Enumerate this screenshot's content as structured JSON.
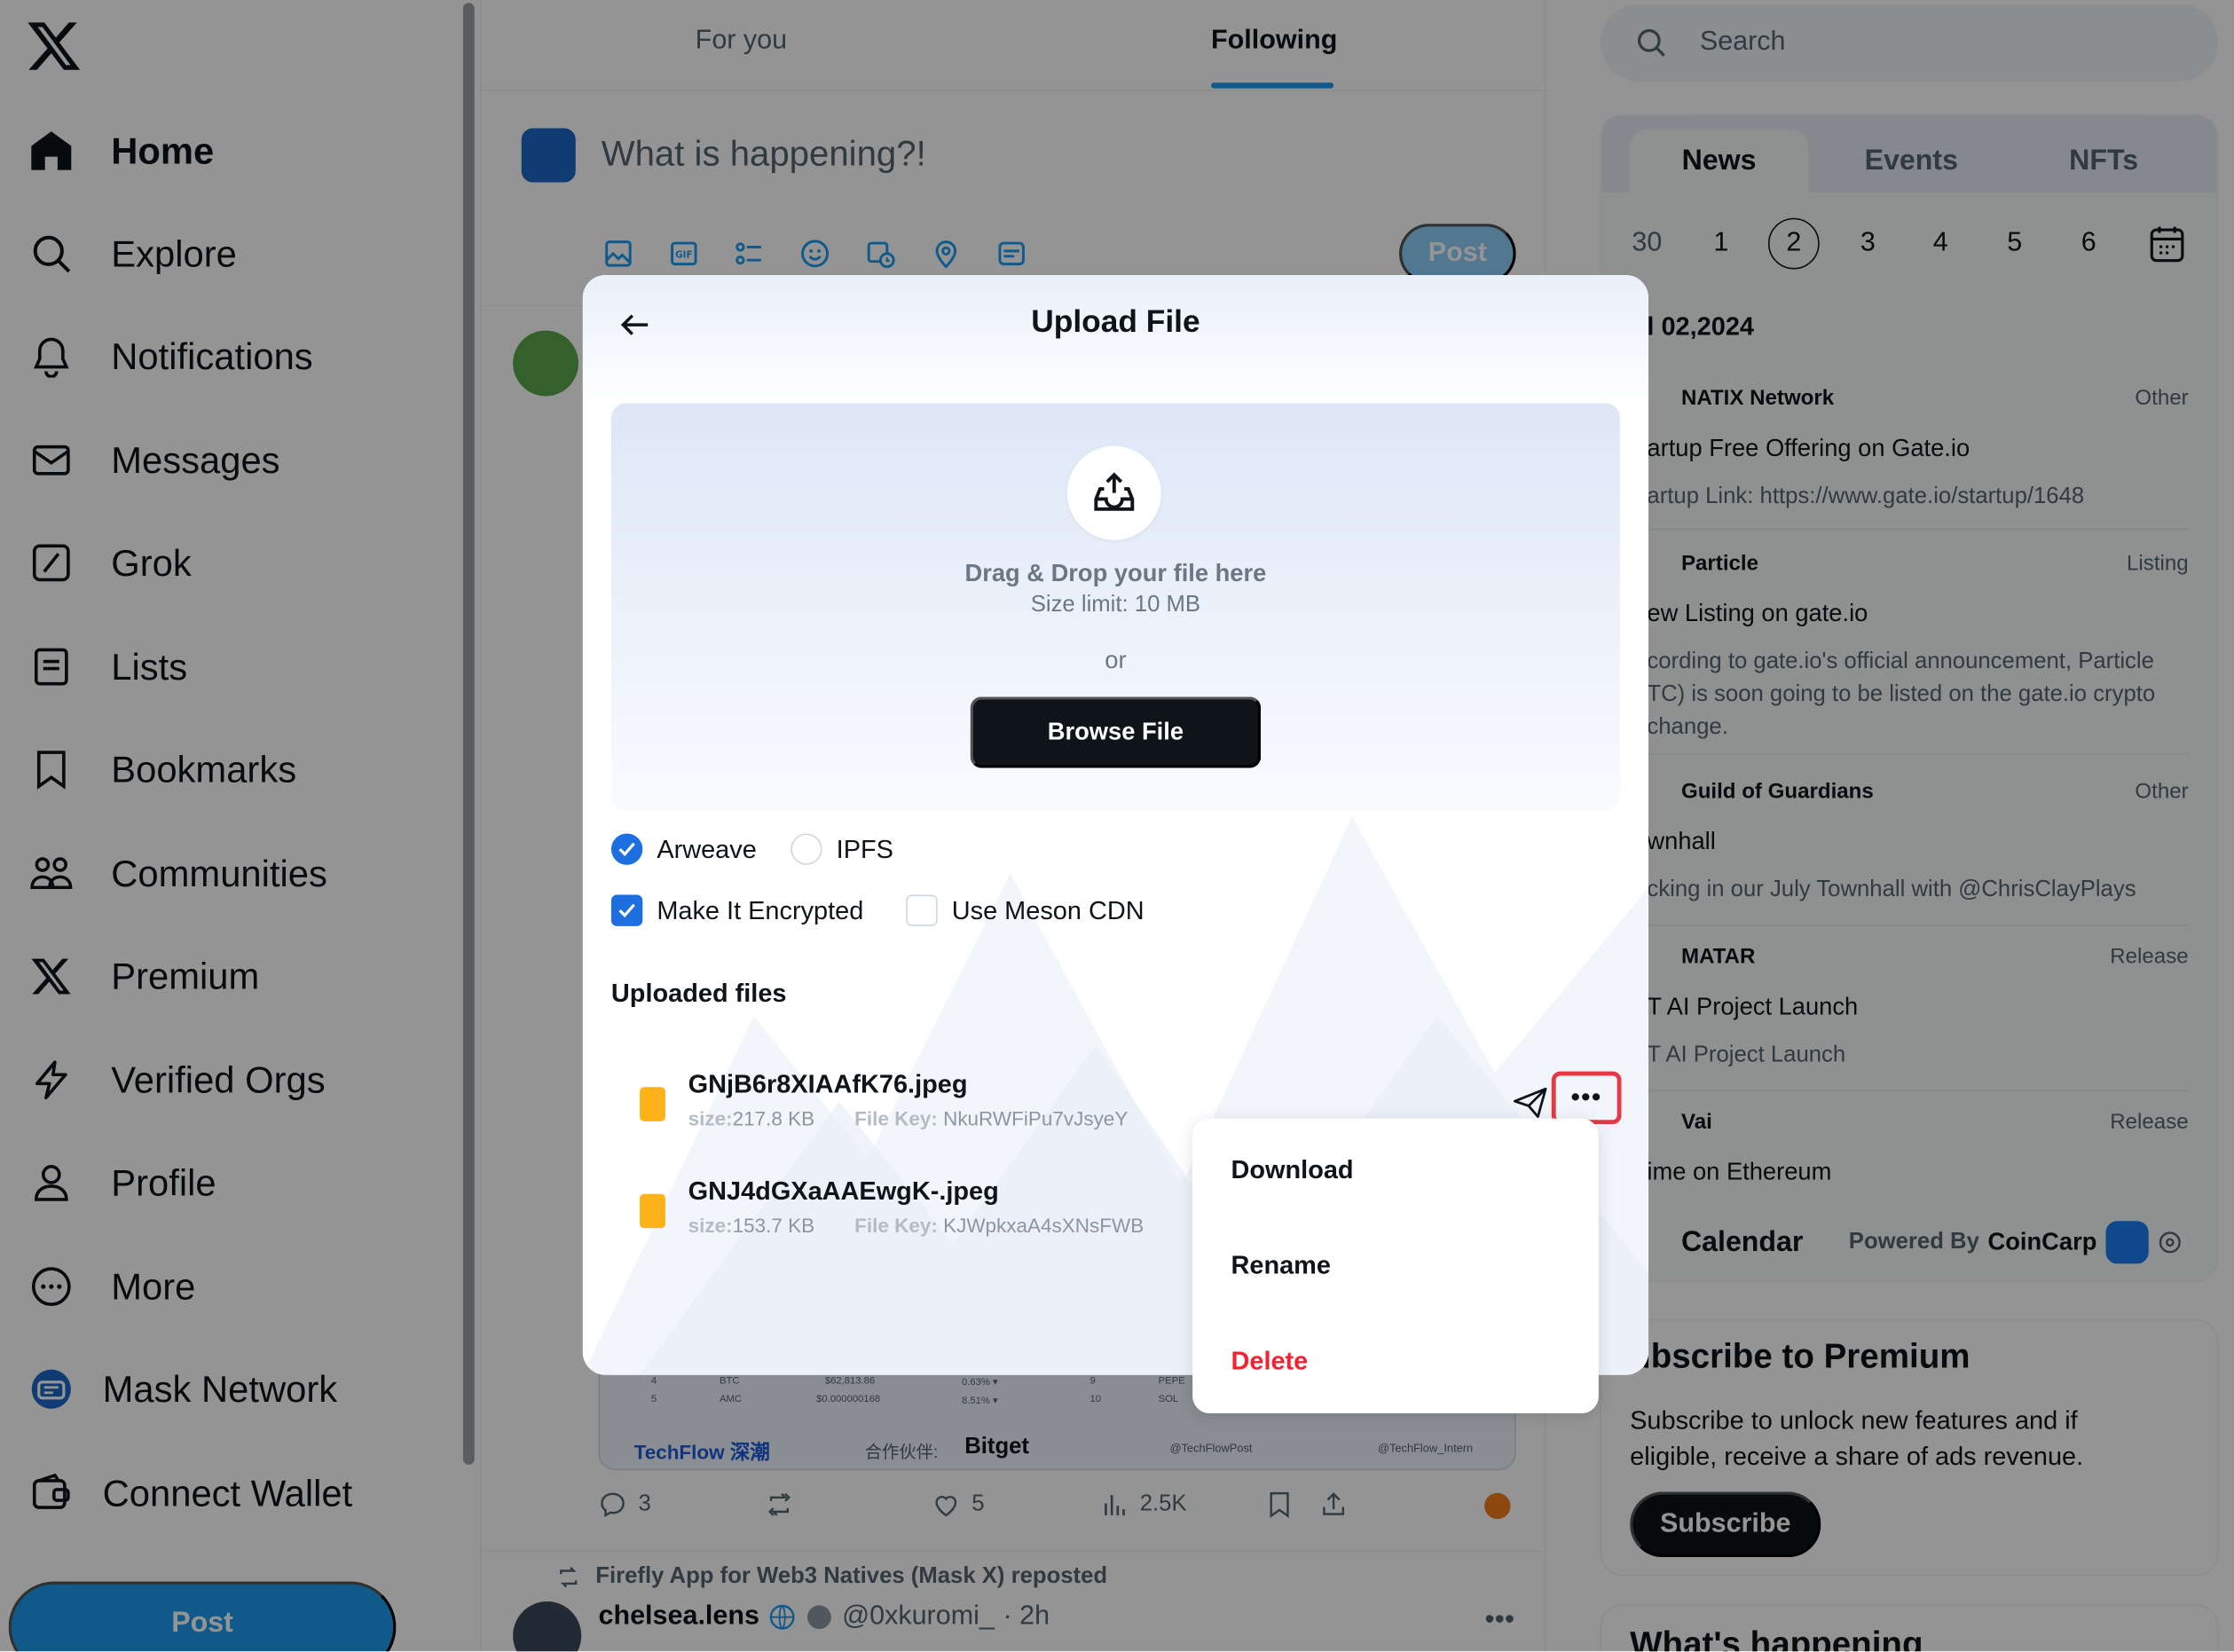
{
  "sidebar": {
    "logo_icon": "x-logo-icon",
    "items": [
      {
        "label": "Home",
        "icon": "home-icon",
        "active": true
      },
      {
        "label": "Explore",
        "icon": "search-icon"
      },
      {
        "label": "Notifications",
        "icon": "bell-icon"
      },
      {
        "label": "Messages",
        "icon": "envelope-icon"
      },
      {
        "label": "Grok",
        "icon": "grok-icon"
      },
      {
        "label": "Lists",
        "icon": "list-icon"
      },
      {
        "label": "Bookmarks",
        "icon": "bookmark-icon"
      },
      {
        "label": "Communities",
        "icon": "people-icon"
      },
      {
        "label": "Premium",
        "icon": "x-premium-icon"
      },
      {
        "label": "Verified Orgs",
        "icon": "lightning-icon"
      },
      {
        "label": "Profile",
        "icon": "person-icon"
      },
      {
        "label": "More",
        "icon": "more-circle-icon"
      },
      {
        "label": "Mask Network",
        "icon": "mask-network-icon"
      },
      {
        "label": "Connect Wallet",
        "icon": "wallet-icon"
      }
    ],
    "post_label": "Post"
  },
  "timeline": {
    "tabs": [
      {
        "label": "For you"
      },
      {
        "label": "Following",
        "active": true
      }
    ],
    "compose": {
      "placeholder": "What is happening?!",
      "post_label": "Post",
      "tools": [
        "image-icon",
        "gif-icon",
        "poll-icon",
        "emoji-icon",
        "schedule-icon",
        "location-icon",
        "mask-plugin-icon"
      ]
    },
    "card": {
      "rows": [
        {
          "n": "4",
          "sym": "BTC",
          "price": "$62,813.86",
          "chg": "0.63% ▾",
          "n2": "9",
          "sym2": "PEPE"
        },
        {
          "n": "5",
          "sym": "AMC",
          "price": "$0.000000168",
          "chg": "8.51% ▾",
          "n2": "10",
          "sym2": "SOL"
        }
      ],
      "brand": "TechFlow 深潮",
      "partner": "合作伙伴:",
      "bitget": "Bitget",
      "handle1": "@TechFlowPost",
      "handle2": "@TechFlow_Intern"
    },
    "actions": {
      "replies": "3",
      "likes": "5",
      "views": "2.5K"
    },
    "repost_text": "Firefly App for Web3 Natives (Mask X) reposted",
    "tweet2": {
      "name": "chelsea.lens",
      "handle": "@0xkuromi_",
      "time": "· 2h"
    }
  },
  "right": {
    "search_placeholder": "Search",
    "news_tabs": [
      {
        "label": "News",
        "active": true
      },
      {
        "label": "Events"
      },
      {
        "label": "NFTs"
      }
    ],
    "dates": [
      {
        "d": "30",
        "dim": true
      },
      {
        "d": "1"
      },
      {
        "d": "2",
        "selected": true
      },
      {
        "d": "3"
      },
      {
        "d": "4"
      },
      {
        "d": "5"
      },
      {
        "d": "6"
      }
    ],
    "news_date": "l 02,2024",
    "news": [
      {
        "source": "NATIX Network",
        "tag": "Other",
        "title": "artup Free Offering on Gate.io",
        "desc": "artup Link: https://www.gate.io/startup/1648"
      },
      {
        "source": "Particle",
        "tag": "Listing",
        "title": "ew Listing on gate.io",
        "desc": "cording to gate.io's official announcement, Particle TC) is soon going to be listed on the gate.io crypto change."
      },
      {
        "source": "Guild of Guardians",
        "tag": "Other",
        "title": "wnhall",
        "desc": "cking in our July Townhall with @ChrisClayPlays"
      },
      {
        "source": "MATAR",
        "tag": "Release",
        "title": "T AI Project Launch",
        "desc": "T AI Project Launch"
      },
      {
        "source": "Vai",
        "tag": "Release",
        "title": "ime on Ethereum",
        "desc": ""
      }
    ],
    "calendar_title": "Calendar",
    "powered_by": "Powered By",
    "coincarp": "CoinCarp",
    "premium": {
      "title": "ubscribe to Premium",
      "text": "Subscribe to unlock new features and if eligible, receive a share of ads revenue.",
      "button": "Subscribe"
    },
    "whats_happening": "What's happening"
  },
  "modal": {
    "title": "Upload File",
    "drop_title": "Drag & Drop your file here",
    "size_limit": "Size limit: 10 MB",
    "or": "or",
    "browse_label": "Browse File",
    "storage": [
      {
        "label": "Arweave",
        "checked": true
      },
      {
        "label": "IPFS",
        "checked": false
      }
    ],
    "options": [
      {
        "label": "Make It Encrypted",
        "checked": true
      },
      {
        "label": "Use Meson CDN",
        "checked": false
      }
    ],
    "uploaded_title": "Uploaded files",
    "files": [
      {
        "name": "GNjB6r8XIAAfK76.jpeg",
        "size_label": "size:",
        "size": "217.8 KB",
        "key_label": "File Key:",
        "key": "NkuRWFiPu7vJsyeY"
      },
      {
        "name": "GNJ4dGXaAAEwgK-.jpeg",
        "size_label": "size:",
        "size": "153.7 KB",
        "key_label": "File Key:",
        "key": "KJWpkxaA4sXNsFWB"
      }
    ],
    "more_label": "•••"
  },
  "menu": {
    "items": [
      {
        "label": "Download"
      },
      {
        "label": "Rename"
      },
      {
        "label": "Delete",
        "danger": true
      }
    ]
  },
  "colors": {
    "accent": "#1d9bf0",
    "checkbox": "#1d6fe0",
    "danger": "#f4212e",
    "highlight": "#e53945",
    "file": "#ffb21a"
  }
}
